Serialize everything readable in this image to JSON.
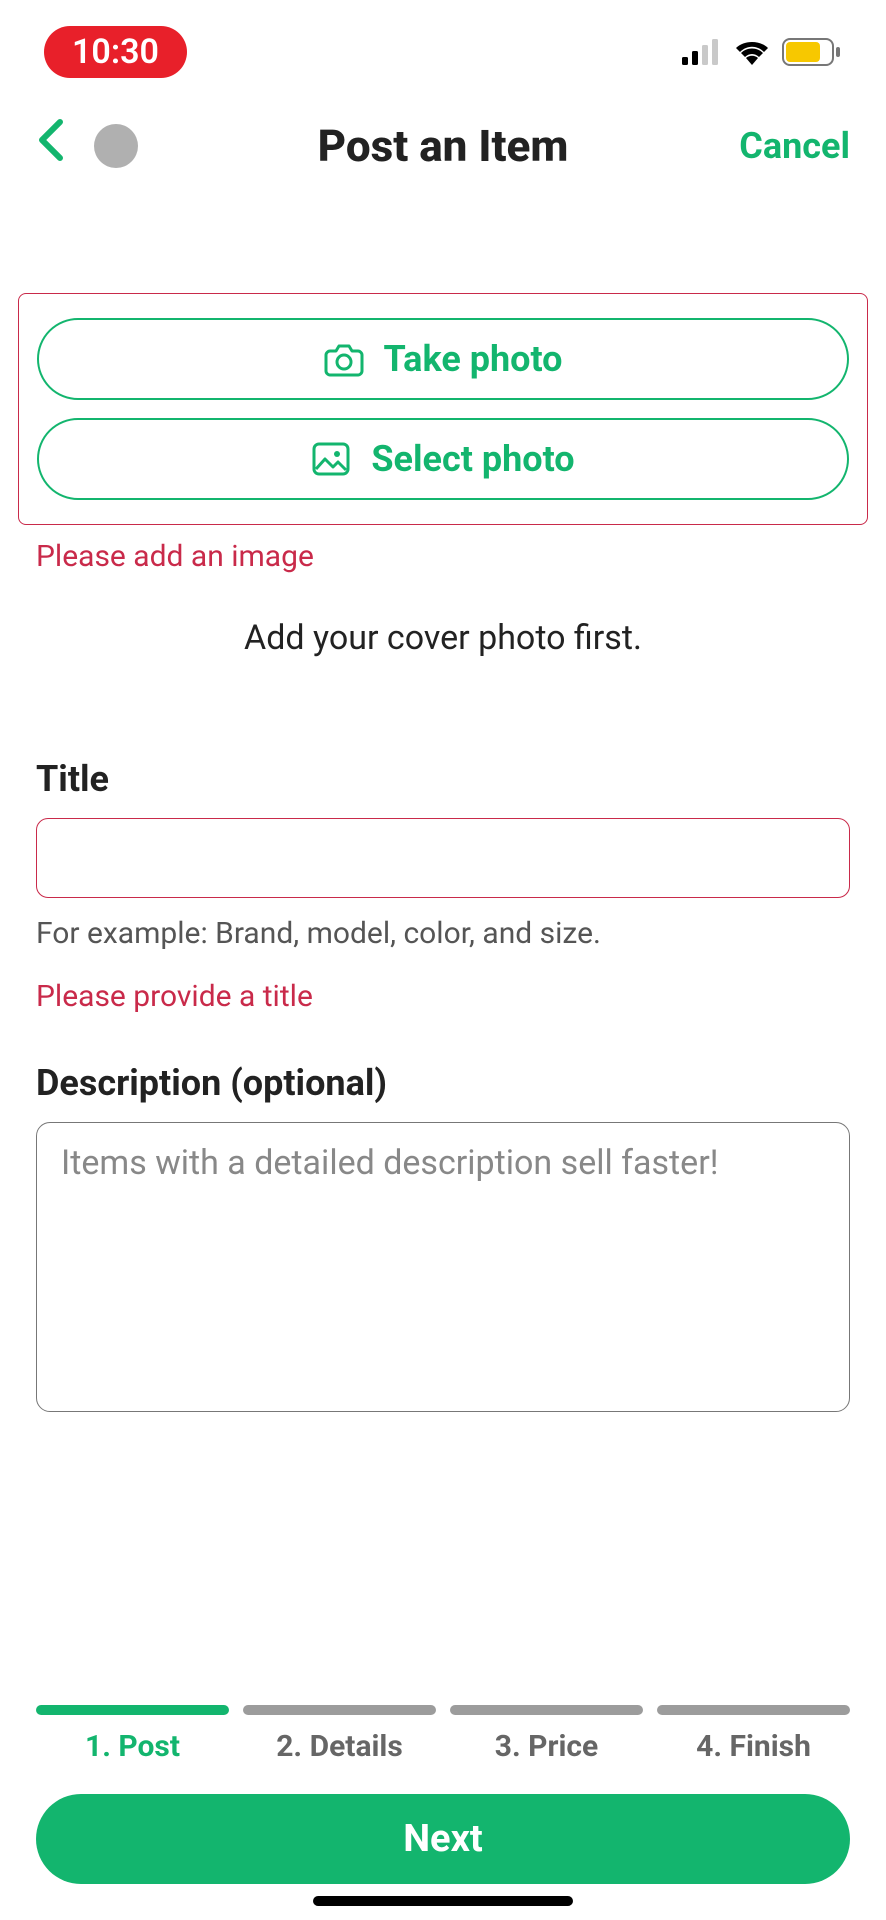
{
  "status": {
    "time": "10:30"
  },
  "header": {
    "title": "Post an Item",
    "cancel": "Cancel"
  },
  "photo": {
    "take": "Take photo",
    "select": "Select photo",
    "error": "Please add an image",
    "hint": "Add your cover photo first."
  },
  "title_section": {
    "label": "Title",
    "value": "",
    "hint": "For example: Brand, model, color, and size.",
    "error": "Please provide a title"
  },
  "description": {
    "label": "Description (optional)",
    "placeholder": "Items with a detailed description sell faster!",
    "value": ""
  },
  "steps": [
    {
      "label": "1. Post",
      "active": true
    },
    {
      "label": "2. Details",
      "active": false
    },
    {
      "label": "3. Price",
      "active": false
    },
    {
      "label": "4. Finish",
      "active": false
    }
  ],
  "next": "Next"
}
